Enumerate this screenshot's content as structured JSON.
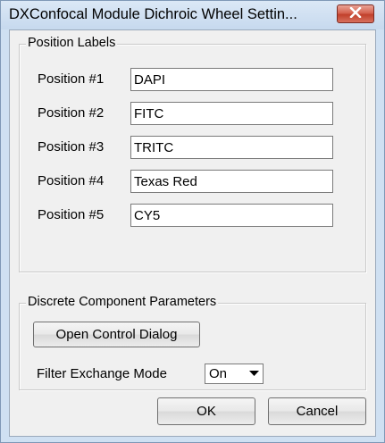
{
  "window": {
    "title": "DXConfocal Module Dichroic Wheel Settin...",
    "close_icon": "close-icon",
    "close_color": "#c8432f"
  },
  "position_labels": {
    "group_title": "Position Labels",
    "rows": [
      {
        "label": "Position #1",
        "value": "DAPI"
      },
      {
        "label": "Position #2",
        "value": "FITC"
      },
      {
        "label": "Position #3",
        "value": "TRITC"
      },
      {
        "label": "Position #4",
        "value": "Texas Red"
      },
      {
        "label": "Position #5",
        "value": "CY5"
      }
    ]
  },
  "discrete_params": {
    "group_title": "Discrete Component Parameters",
    "open_button_label": "Open Control Dialog",
    "filter_exchange_label": "Filter Exchange Mode",
    "filter_exchange_value": "On",
    "dropdown_icon": "chevron-down-icon"
  },
  "footer": {
    "ok_label": "OK",
    "cancel_label": "Cancel"
  }
}
